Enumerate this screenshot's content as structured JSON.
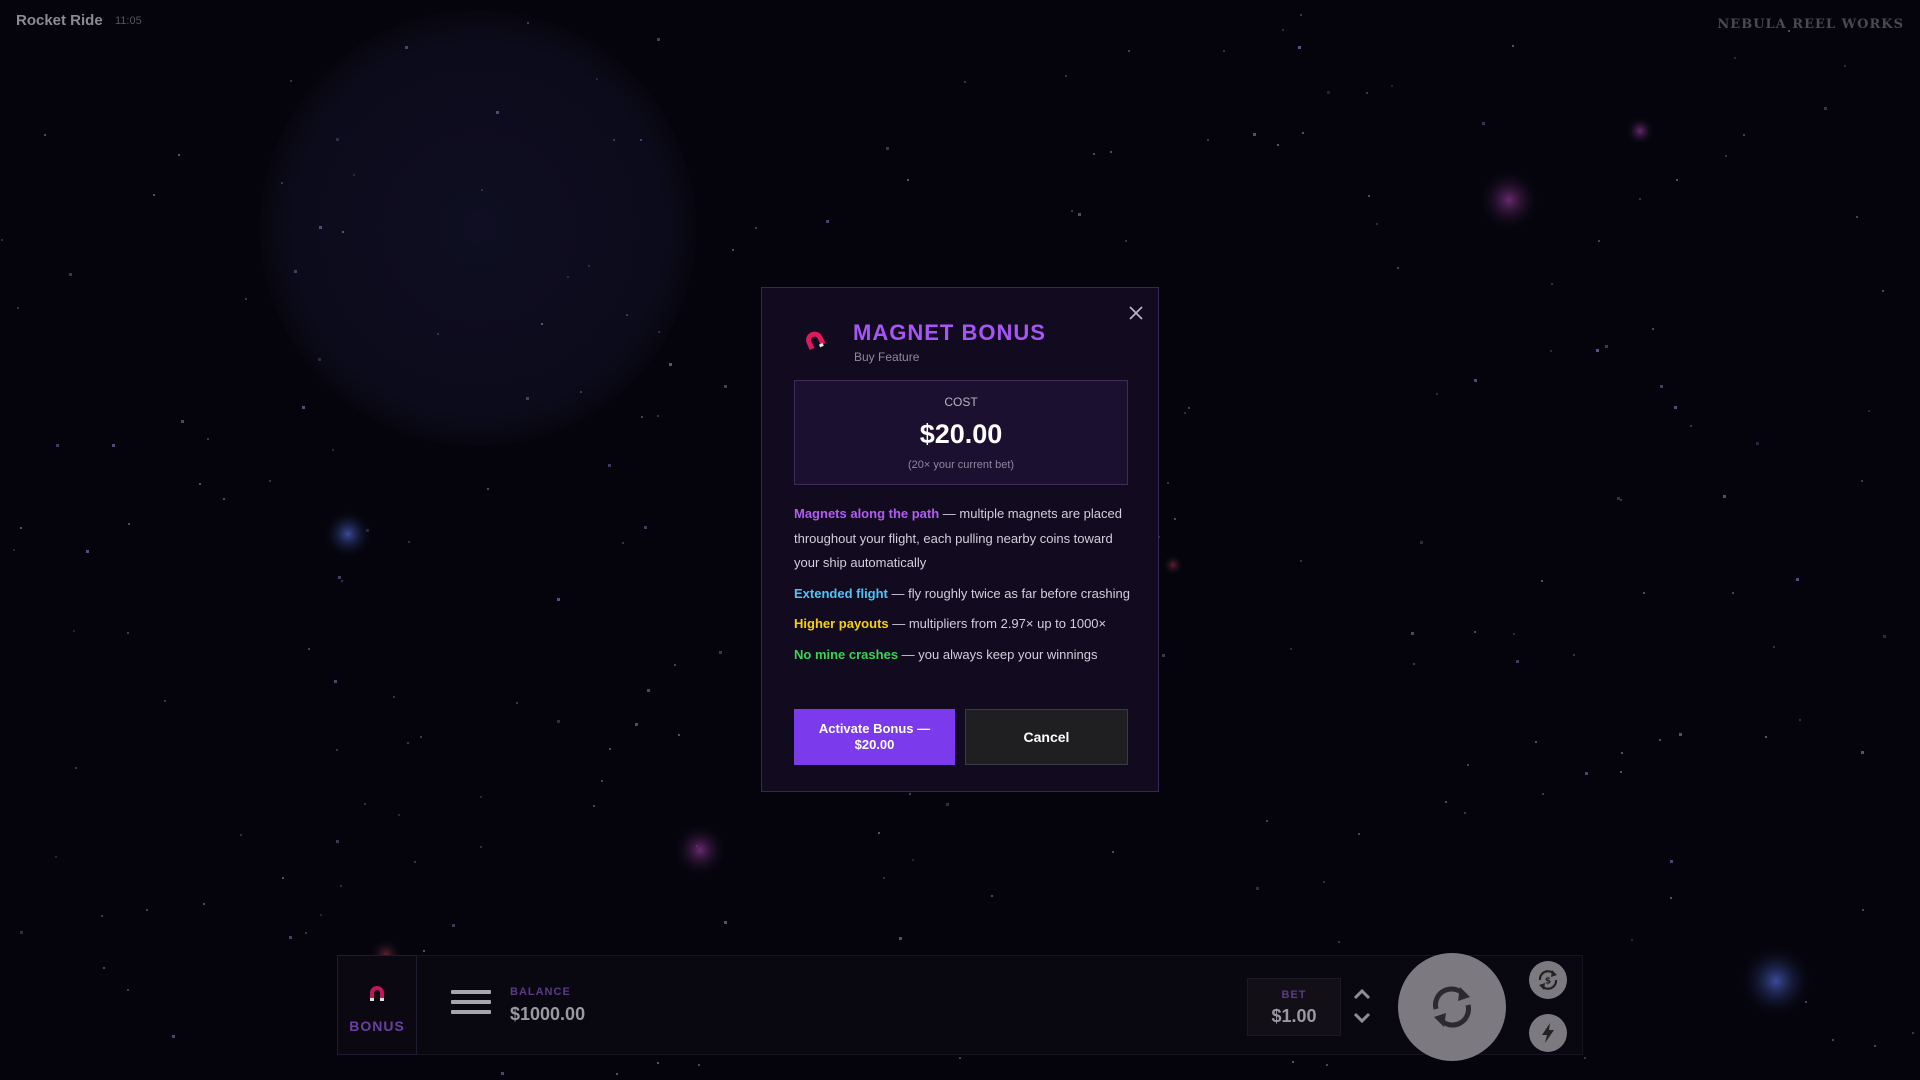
{
  "header": {
    "game_title": "Rocket Ride",
    "time": "11:05",
    "studio": "NEBULA REEL WORKS"
  },
  "modal": {
    "title": "MAGNET BONUS",
    "subtitle": "Buy Feature",
    "cost_label": "COST",
    "cost_value": "$20.00",
    "cost_note": "(20× your current bet)",
    "features": [
      {
        "name": "Magnets along the path",
        "text": " — multiple magnets are placed throughout your flight, each pulling nearby coins toward your ship automatically"
      },
      {
        "name": "Extended flight",
        "text": " — fly roughly twice as far before crashing"
      },
      {
        "name": "Higher payouts",
        "text": " — multipliers from 2.97× up to 1000×"
      },
      {
        "name": "No mine crashes",
        "text": " — you always keep your winnings"
      }
    ],
    "activate_label": "Activate Bonus — $20.00",
    "cancel_label": "Cancel",
    "icon": "magnet-icon",
    "close_icon": "close-icon"
  },
  "bottom_bar": {
    "bonus_label": "BONUS",
    "balance_label": "BALANCE",
    "balance_value": "$1000.00",
    "bet_label": "BET",
    "bet_value": "$1.00",
    "icons": [
      "magnet-icon",
      "menu-icon",
      "chevron-up-icon",
      "chevron-down-icon",
      "spin-icon",
      "autoplay-icon",
      "turbo-icon"
    ]
  },
  "colors": {
    "accent": "#7c3aed",
    "title_purple": "#a855f7",
    "feature_purple": "#b15cf5",
    "feature_blue": "#4fc3f7",
    "feature_yellow": "#f5d10a",
    "feature_green": "#39d353",
    "background": "#05040c"
  }
}
